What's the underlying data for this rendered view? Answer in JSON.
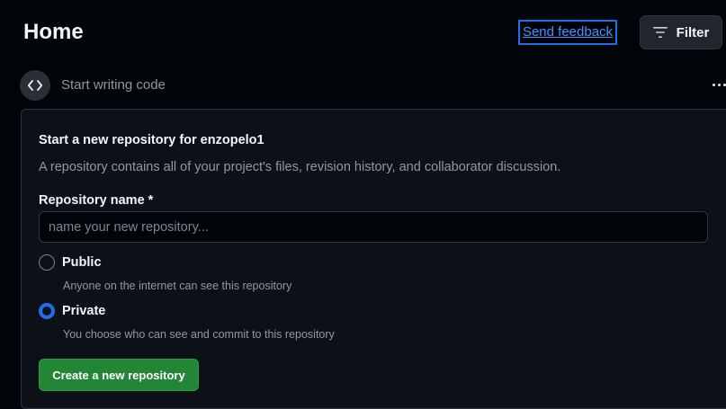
{
  "header": {
    "title": "Home",
    "feedback_label": "Send feedback",
    "filter_label": "Filter"
  },
  "feed": {
    "label": "Start writing code"
  },
  "new_repo": {
    "heading": "Start a new repository for enzopelo1",
    "description": "A repository contains all of your project's files, revision history, and collaborator discussion.",
    "name_label": "Repository name *",
    "name_value": "",
    "name_placeholder": "name your new repository...",
    "visibility_options": [
      {
        "label": "Public",
        "hint": "Anyone on the internet can see this repository",
        "selected": false
      },
      {
        "label": "Private",
        "hint": "You choose who can see and commit to this repository",
        "selected": true
      }
    ],
    "create_label": "Create a new repository"
  },
  "colors": {
    "background": "#010409",
    "card": "#0d1117",
    "accent": "#1f6feb",
    "link": "#4493f8",
    "primary_button": "#238636"
  },
  "icons": {
    "filter": "filter-icon",
    "code": "code-icon",
    "more": "kebab-horizontal-icon"
  }
}
